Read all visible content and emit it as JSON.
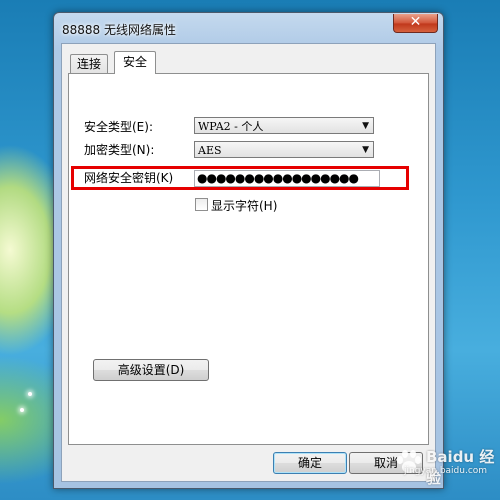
{
  "window": {
    "title": "88888 无线网络属性",
    "close_glyph": "✕"
  },
  "tabs": [
    {
      "label": "连接",
      "selected": false
    },
    {
      "label": "安全",
      "selected": true
    }
  ],
  "form": {
    "security_type_label": "安全类型(E):",
    "security_type_value": "WPA2 - 个人",
    "encryption_type_label": "加密类型(N):",
    "encryption_type_value": "AES",
    "network_key_label": "网络安全密钥(K)",
    "network_key_masked": "●●●●●●●●●●●●●●●●●",
    "show_chars_label": "显示字符(H)",
    "show_chars_checked": false,
    "advanced_button": "高级设置(D)"
  },
  "buttons": {
    "ok": "确定",
    "cancel": "取消"
  },
  "watermark": {
    "main": "Baidu 经验",
    "url": "jingyan.baidu.com"
  },
  "colors": {
    "highlight": "#e60000",
    "close_button": "#c0381b"
  },
  "icons": {
    "dropdown": "chevron-down-icon",
    "close": "close-icon"
  }
}
